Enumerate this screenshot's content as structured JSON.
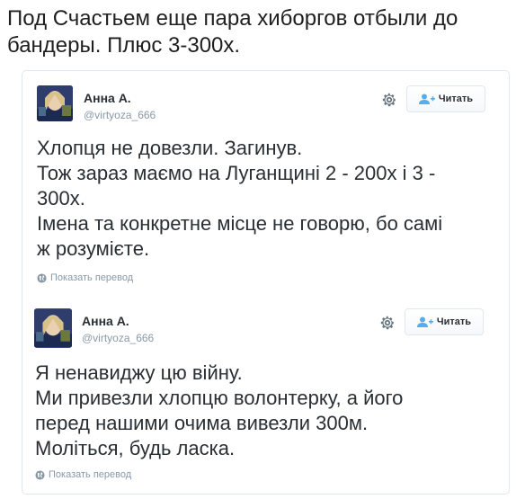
{
  "caption": "Под Счастьем еще пара хиборгов отбыли до бандеры. Плюс 3-300х.",
  "caption_lines": [
    "Под Счастьем еще пара хиборгов отбыли до",
    "бандеры. Плюс 3-300х."
  ],
  "tweets": [
    {
      "author": "Анна А.",
      "handle": "@virtyoza_666",
      "follow_label": "Читать",
      "text_lines": [
        "Хлопця не довезли. Загинув.",
        "Тож зараз маємо на Луганщині 2 - 200х і 3 -",
        "300х.",
        "Імена та конкретне місце не говорю, бо самі",
        "ж розумієте."
      ],
      "translate_label": "Показать перевод"
    },
    {
      "author": "Анна А.",
      "handle": "@virtyoza_666",
      "follow_label": "Читать",
      "text_lines": [
        "Я ненавиджу цю війну.",
        "Ми привезли хлопцю волонтерку, а його",
        "перед нашими очима вивезли 300м.",
        "Моліться, будь ласка."
      ],
      "translate_label": "Показать перевод"
    }
  ],
  "icons": {
    "settings": "gear-icon",
    "follow": "add-user-icon",
    "translate": "globe-icon"
  },
  "colors": {
    "text": "#292f33",
    "muted": "#8899a6",
    "follow_icon": "#55acee",
    "border": "#e1e8ed"
  }
}
